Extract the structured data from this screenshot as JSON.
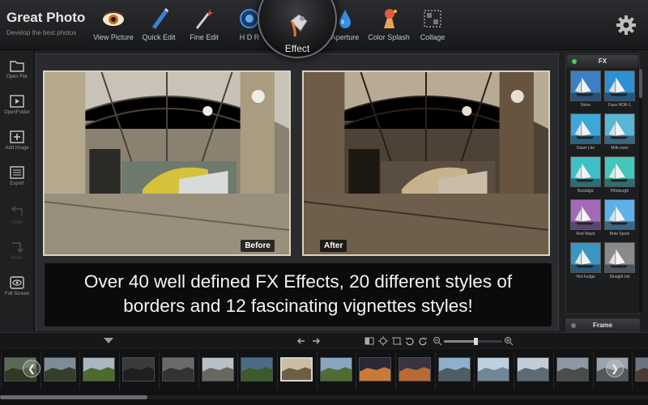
{
  "brand": {
    "title": "Great Photo",
    "subtitle": "Develop the best photos"
  },
  "toolbar": [
    {
      "label": "View Picture",
      "icon": "eye-icon"
    },
    {
      "label": "Quick Edit",
      "icon": "pencil-icon"
    },
    {
      "label": "Fine Edit",
      "icon": "magic-wand-icon"
    },
    {
      "label": "H D R",
      "icon": "hdr-icon"
    },
    {
      "label": "Effect",
      "icon": "paint-bucket-icon",
      "selected": true
    },
    {
      "label": "Aperture",
      "icon": "water-drop-icon"
    },
    {
      "label": "Color Splash",
      "icon": "splash-icon"
    },
    {
      "label": "Collage",
      "icon": "collage-icon"
    }
  ],
  "settings_icon": "gear-icon",
  "sidebar": [
    {
      "label": "Open File",
      "icon": "folder-icon",
      "enabled": true
    },
    {
      "label": "OpenFolder",
      "icon": "play-folder-icon",
      "enabled": true
    },
    {
      "label": "Add Image",
      "icon": "add-image-icon",
      "enabled": true
    },
    {
      "label": "Export",
      "icon": "export-icon",
      "enabled": true
    },
    {
      "label": "Undo",
      "icon": "undo-icon",
      "enabled": false
    },
    {
      "label": "Redo",
      "icon": "redo-icon",
      "enabled": false
    },
    {
      "label": "Full Screen",
      "icon": "eye-icon",
      "enabled": true
    }
  ],
  "preview": {
    "before_label": "Before",
    "after_label": "After"
  },
  "caption": {
    "line1": "Over 40 well defined FX Effects, 20 different styles of",
    "line2": "borders and 12 fascinating vignettes styles!"
  },
  "fx_panel": {
    "title": "FX",
    "effects": [
      {
        "name": "None",
        "tint": "#3d7fc4"
      },
      {
        "name": "Faux HDR-1",
        "tint": "#2f8fd4"
      },
      {
        "name": "Dawn Lite",
        "tint": "#3aa8d8"
      },
      {
        "name": "Milk-oven",
        "tint": "#57b6d4"
      },
      {
        "name": "Nostalgic",
        "tint": "#3fc0c7"
      },
      {
        "name": "Pittsburgh",
        "tint": "#44c6b8"
      },
      {
        "name": "Red Wash",
        "tint": "#a46ab8"
      },
      {
        "name": "Brite Spots",
        "tint": "#5fb0e8"
      },
      {
        "name": "Hot Fudge",
        "tint": "#3a96c2"
      },
      {
        "name": "Straight Ink",
        "tint": "#8a8a8a"
      }
    ]
  },
  "frame_panel": {
    "title": "Frame"
  },
  "controls": {
    "collapse_icon": "chevron-down-icon",
    "prev_icon": "arrow-left-icon",
    "next_icon": "arrow-right-icon",
    "zoom_level": 0.55
  },
  "filmstrip": {
    "selected_index": 7,
    "scroll_fraction": 0.23,
    "thumbs": [
      {
        "sky": "#5a6a55",
        "ground": "#2f3a22"
      },
      {
        "sky": "#7d8c96",
        "ground": "#34402a"
      },
      {
        "sky": "#a9b7c2",
        "ground": "#4f6b2c"
      },
      {
        "sky": "#3a3a3a",
        "ground": "#1f1f1f"
      },
      {
        "sky": "#6a6a6a",
        "ground": "#333333"
      },
      {
        "sky": "#b7c0c6",
        "ground": "#6a6660"
      },
      {
        "sky": "#4d6a86",
        "ground": "#3d5a2a"
      },
      {
        "sky": "#c9bfa4",
        "ground": "#6d5f45"
      },
      {
        "sky": "#8aa5c2",
        "ground": "#516b35"
      },
      {
        "sky": "#2a2836",
        "ground": "#c87a3a"
      },
      {
        "sky": "#3a3340",
        "ground": "#b86a34"
      },
      {
        "sky": "#8fb0cc",
        "ground": "#4c5f66"
      },
      {
        "sky": "#bcd0df",
        "ground": "#718796"
      },
      {
        "sky": "#c2ccd6",
        "ground": "#5e6b74"
      },
      {
        "sky": "#8e98a4",
        "ground": "#4a4e4a"
      },
      {
        "sky": "#9aa4ad",
        "ground": "#55585a"
      },
      {
        "sky": "#6b7480",
        "ground": "#4a3c32"
      }
    ]
  }
}
